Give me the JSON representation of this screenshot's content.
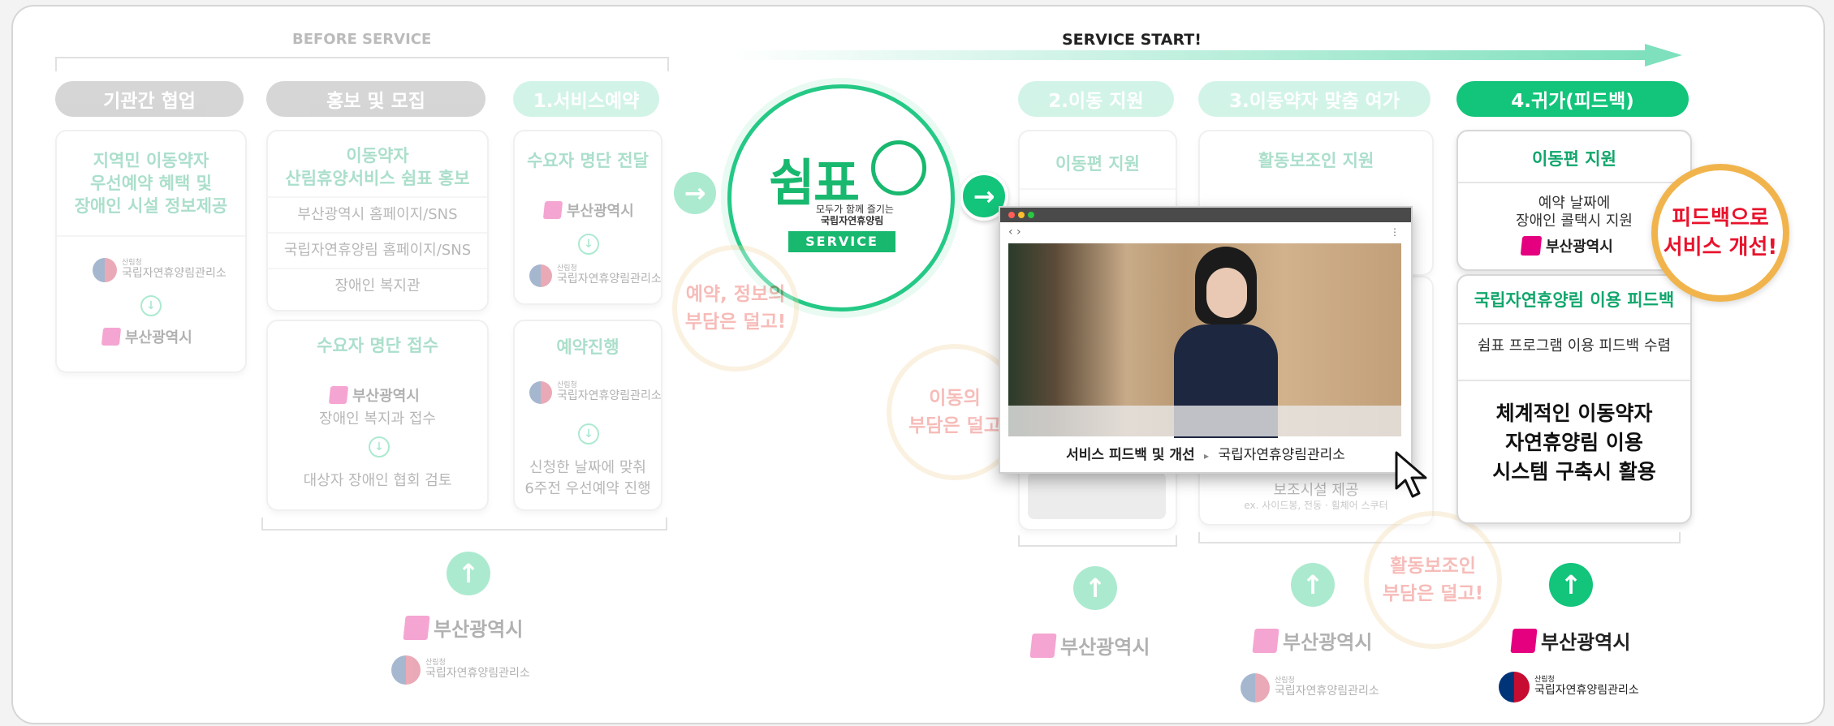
{
  "header": {
    "before_label": "BEFORE SERVICE",
    "start_label": "SERVICE START!"
  },
  "colors": {
    "accent": "#13c47b",
    "mint": "#7fe0bd",
    "busan_pink": "#e4007f",
    "bubble_red": "#e8433a",
    "bubble_border": "#f1b44c"
  },
  "stages": {
    "s0": "기관간 협업",
    "s1": "홍보 및 모집",
    "s2": "1.서비스예약",
    "s3": "2.이동 지원",
    "s4": "3.이동약자 맞춤 여가",
    "s5": "4.귀가(피드백)"
  },
  "col0": {
    "head1": "지역민 이동약자",
    "head2": "우선예약 혜택 및",
    "head3": "장애인 시설 정보제공"
  },
  "col1": {
    "head1": "이동약자",
    "head2": "산림휴양서비스 쉼표 홍보",
    "rows": [
      "부산광역시 홈페이지/SNS",
      "국립자연휴양림 홈페이지/SNS",
      "장애인 복지관"
    ],
    "card2_head": "수요자 명단 접수",
    "card2_line1": "장애인 복지과 접수",
    "card2_line2": "대상자 장애인 협회 검토"
  },
  "col2": {
    "card1_head": "수요자 명단 전달",
    "card2_head": "예약진행",
    "card2_line1": "신청한 날짜에 맞춰",
    "card2_line2": "6주전 우선예약 진행"
  },
  "col3": {
    "head": "이동편 지원"
  },
  "col4": {
    "head": "활동보조인 지원",
    "row_a": "보조시설 제공",
    "row_b": "ex. 사이드봉, 전동 · 휠체어 스쿠터"
  },
  "col5": {
    "card1_head": "이동편 지원",
    "card1_line1": "예약 날짜에",
    "card1_line2": "장애인 콜택시 지원",
    "card2_head": "국립자연휴양림 이용 피드백",
    "card2_row": "쉼표 프로그램 이용 피드백 수렴",
    "card2_big1": "체계적인 이동약자",
    "card2_big2": "자연휴양림 이용",
    "card2_big3": "시스템 구축시 활용"
  },
  "logo": {
    "title": "쉼표",
    "sub1": "모두가 함께 즐기는",
    "sub2": "국립자연휴양림",
    "badge": "SERVICE"
  },
  "orgs": {
    "busan": "부산광역시",
    "forest_small": "산림청",
    "forest": "국립자연휴양림관리소"
  },
  "bubbles": {
    "b1_l1": "예약, 정보의",
    "b1_l2": "부담은 덜고!",
    "b2_l1": "이동의",
    "b2_l2": "부담은 덜고",
    "b3_l1": "활동보조인",
    "b3_l2": "부담은 덜고!",
    "b4_l1": "피드백으로",
    "b4_l2": "서비스 개선!"
  },
  "popup": {
    "nav": "‹ ›",
    "caption_bold": "서비스 피드백 및 개선",
    "caption_sep": "▸",
    "caption_org": "국립자연휴양림관리소"
  }
}
